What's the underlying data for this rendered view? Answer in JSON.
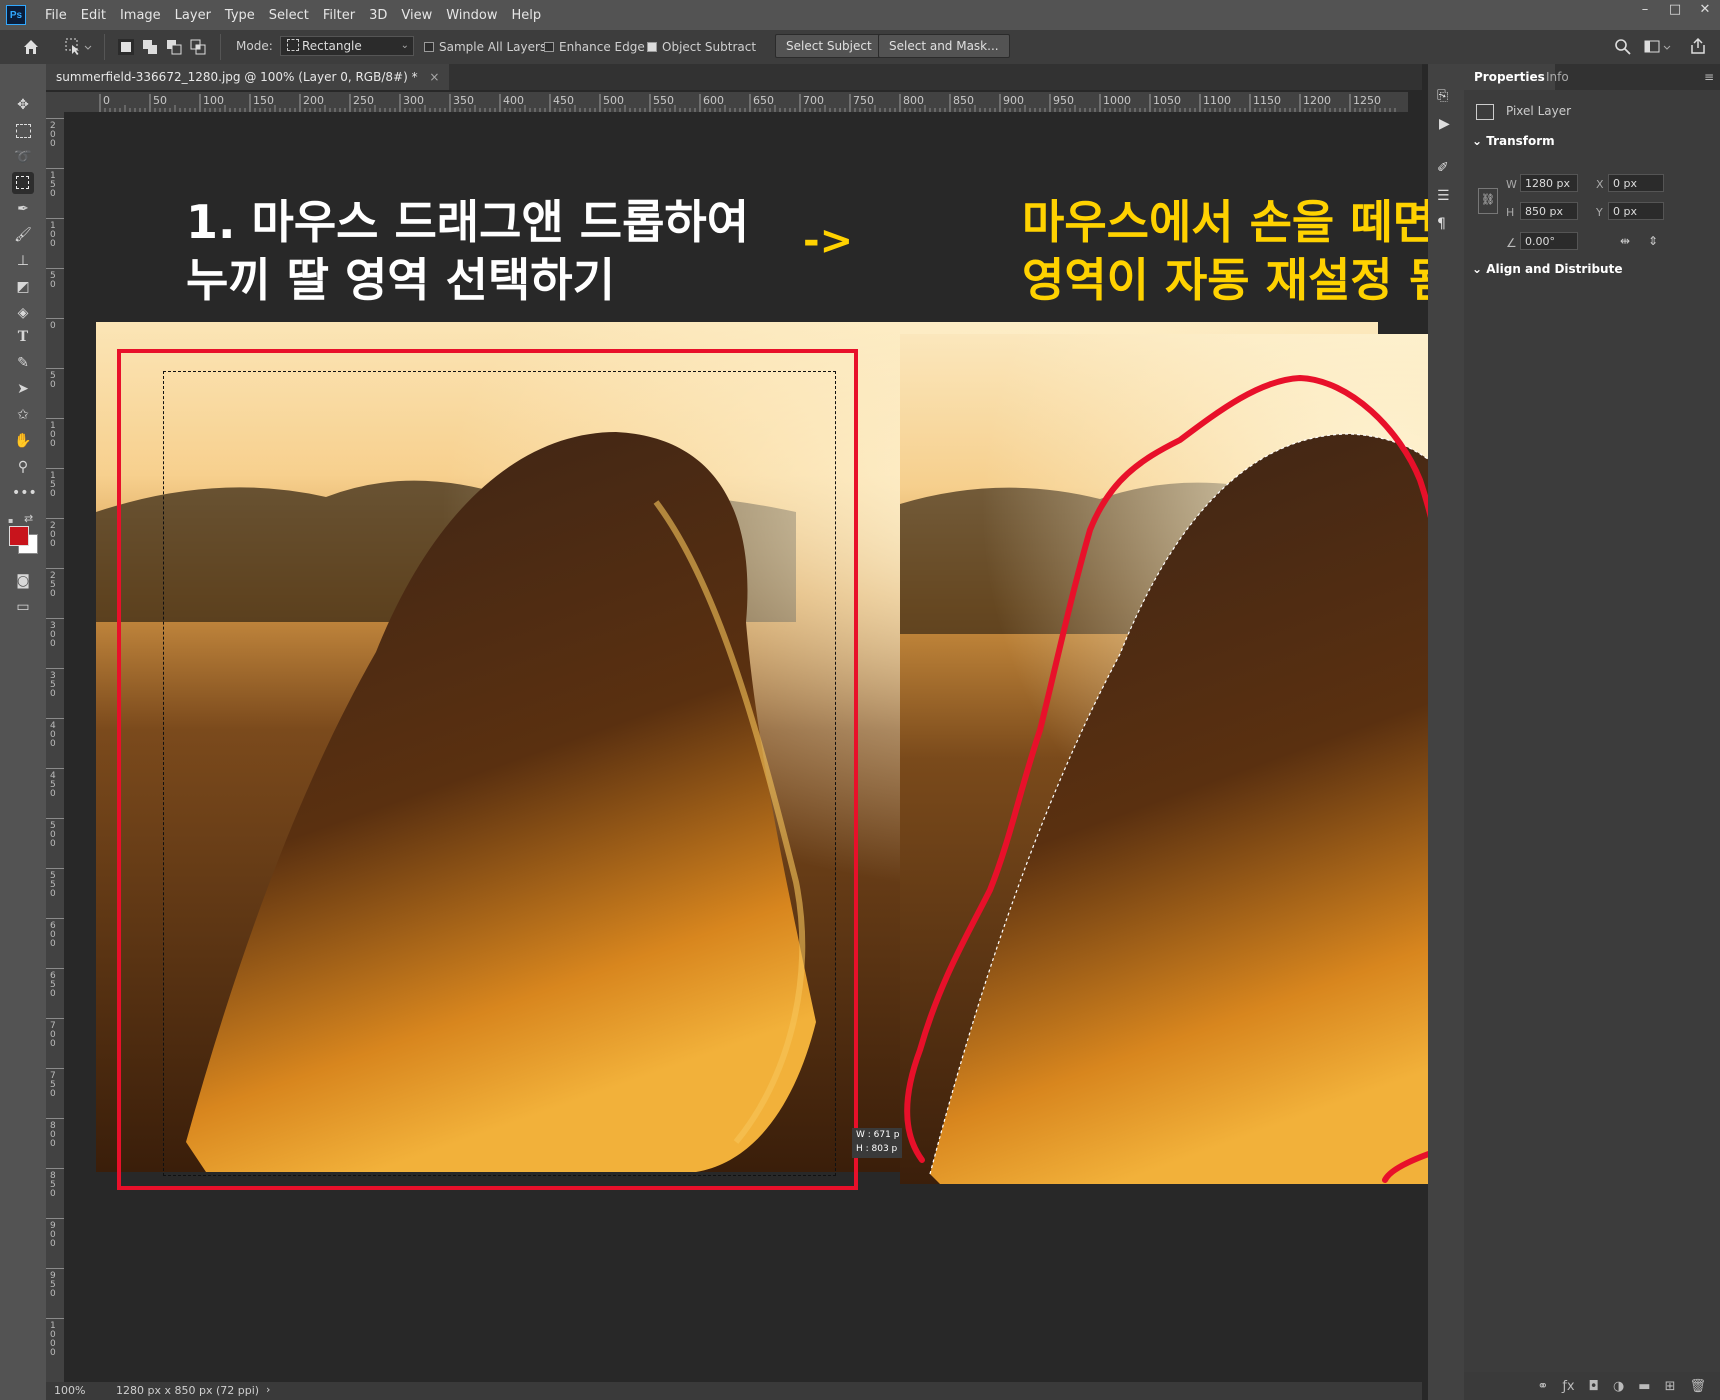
{
  "app": {
    "logo": "Ps"
  },
  "menu": [
    "File",
    "Edit",
    "Image",
    "Layer",
    "Type",
    "Select",
    "Filter",
    "3D",
    "View",
    "Window",
    "Help"
  ],
  "window_controls": [
    "–",
    "□",
    "✕"
  ],
  "options": {
    "mode_label": "Mode:",
    "mode_value": "Rectangle",
    "sample_all_layers": "Sample All Layers",
    "enhance_edge": "Enhance Edge",
    "object_subtract": "Object Subtract",
    "select_subject": "Select Subject",
    "select_and_mask": "Select and Mask..."
  },
  "document_tab": "summerfield-336672_1280.jpg @ 100% (Layer 0, RGB/8#) *",
  "document_tab_close": "×",
  "ruler": {
    "h_labels": [
      "0",
      "50",
      "100",
      "150",
      "200",
      "250",
      "300",
      "350",
      "400",
      "450",
      "500",
      "550",
      "600",
      "650",
      "700",
      "750",
      "800",
      "850",
      "900",
      "950",
      "1000",
      "1050",
      "1100",
      "1150",
      "1200",
      "1250"
    ],
    "v_labels": [
      "2 0 0",
      "1 5 0",
      "1 0 0",
      "5 0",
      "0",
      "5 0",
      "1 0 0",
      "1 5 0",
      "2 0 0",
      "2 5 0",
      "3 0 0",
      "3 5 0",
      "4 0 0",
      "4 5 0",
      "5 0 0",
      "5 5 0",
      "6 0 0",
      "6 5 0",
      "7 0 0",
      "7 5 0",
      "8 0 0",
      "8 5 0",
      "9 0 0",
      "9 5 0",
      "1 0 0 0"
    ]
  },
  "annotations": {
    "left_line1": "1. 마우스 드래그앤 드롭하여",
    "left_line2": "누끼 딸 영역 선택하기",
    "arrow": "->",
    "right_line1": "마우스에서 손을 떼면",
    "right_line2": "영역이 자동 재설정 됨"
  },
  "size_readout": {
    "w": "W : 671 p",
    "h": "H : 803 p"
  },
  "properties": {
    "tab_properties": "Properties",
    "tab_info": "Info",
    "layer_type": "Pixel Layer",
    "transform": "Transform",
    "w_label": "W",
    "w_value": "1280 px",
    "h_label": "H",
    "h_value": "850 px",
    "x_label": "X",
    "x_value": "0 px",
    "y_label": "Y",
    "y_value": "0 px",
    "angle_value": "0.00°",
    "align_distribute": "Align and Distribute"
  },
  "status": {
    "zoom": "100%",
    "doc_info": "1280 px x 850 px (72 ppi)",
    "arrow": "›"
  },
  "colors": {
    "accent_red": "#e8102a",
    "annotation_yellow": "#ffd200",
    "foreground_swatch": "#c8141c",
    "background_swatch": "#ffffff"
  }
}
